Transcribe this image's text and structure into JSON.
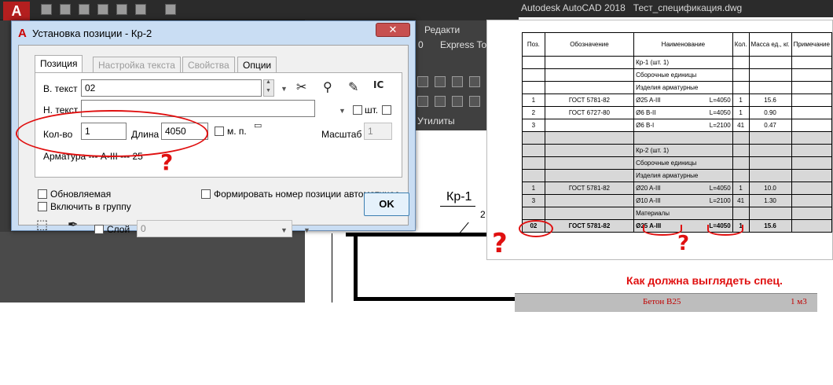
{
  "app": {
    "title_bar": "Autodesk AutoCAD 2018",
    "file": "Тест_спецификация.dwg",
    "ribbon": {
      "tab_redact": "Редакти",
      "tab_express": "Express Too",
      "num": "0",
      "utilities": "Утилиты"
    },
    "logo_letter": "A"
  },
  "drawing": {
    "label_kr1": "Кр-1",
    "leader_digit": "2"
  },
  "dialog": {
    "title": "Установка позиции - Кр-2",
    "close": "✕",
    "tabs": [
      {
        "label": "Позиция"
      },
      {
        "label": "Настройка текста"
      },
      {
        "label": "Свойства"
      },
      {
        "label": "Опции"
      }
    ],
    "v_text_label": "В. текст",
    "v_text_value": "02",
    "n_text_label": "Н. текст",
    "n_text_value": "",
    "sht_label": "шт.",
    "kol_label": "Кол-во",
    "kol_value": "1",
    "dlina_label": "Длина",
    "dlina_value": "4050",
    "mp_label": "м. п.",
    "masshtab_label": "Масштаб",
    "masshtab_value": "1",
    "armatura_text": "Арматура  ---  A-III  ---  25",
    "obnovl_label": "Обновляемая",
    "vkl_label": "Включить в группу",
    "form_label": "Формировать номер позиции автоматичес",
    "sloy_label": "Слой",
    "sloy_value": "0",
    "ok_label": "OK"
  },
  "annotations": {
    "q_left": "?",
    "q_mid": "?",
    "q_dialog": "?"
  },
  "spec": {
    "headers": [
      "Поз.",
      "Обозначение",
      "Наименование",
      "Кол.",
      "Масса ед., кг.",
      "Примечание"
    ],
    "rows": [
      {
        "pos": "",
        "obozn": "",
        "name": "Кр-1 (шт. 1)",
        "L": "",
        "kol": "",
        "massa": "",
        "style": ""
      },
      {
        "pos": "",
        "obozn": "",
        "name": "Сборочные единицы",
        "L": "",
        "kol": "",
        "massa": "",
        "style": ""
      },
      {
        "pos": "",
        "obozn": "",
        "name": "Изделия арматурные",
        "L": "",
        "kol": "",
        "massa": "",
        "style": ""
      },
      {
        "pos": "1",
        "obozn": "ГОСТ 5781-82",
        "name": "Ø25 A-III",
        "L": "L=4050",
        "kol": "1",
        "massa": "15.6",
        "style": ""
      },
      {
        "pos": "2",
        "obozn": "ГОСТ 6727-80",
        "name": "Ø6 B-II",
        "L": "L=4050",
        "kol": "1",
        "massa": "0.90",
        "style": ""
      },
      {
        "pos": "3",
        "obozn": "",
        "name": "Ø6 B-I",
        "L": "L=2100",
        "kol": "41",
        "massa": "0.47",
        "style": ""
      },
      {
        "pos": "",
        "obozn": "",
        "name": "",
        "L": "",
        "kol": "",
        "massa": "",
        "style": "dim"
      },
      {
        "pos": "",
        "obozn": "",
        "name": "Кр-2 (шт. 1)",
        "L": "",
        "kol": "",
        "massa": "",
        "style": "dim"
      },
      {
        "pos": "",
        "obozn": "",
        "name": "Сборочные единицы",
        "L": "",
        "kol": "",
        "massa": "",
        "style": "dim"
      },
      {
        "pos": "",
        "obozn": "",
        "name": "Изделия арматурные",
        "L": "",
        "kol": "",
        "massa": "",
        "style": "dim"
      },
      {
        "pos": "1",
        "obozn": "ГОСТ 5781-82",
        "name": "Ø20 A-III",
        "L": "L=4050",
        "kol": "1",
        "massa": "10.0",
        "style": "dim"
      },
      {
        "pos": "3",
        "obozn": "",
        "name": "Ø10 A-III",
        "L": "L=2100",
        "kol": "41",
        "massa": "1.30",
        "style": "dim"
      },
      {
        "pos": "",
        "obozn": "",
        "name": "Материалы",
        "L": "",
        "kol": "",
        "massa": "",
        "style": "dim"
      },
      {
        "pos": "02",
        "obozn": "ГОСТ 5781-82",
        "name": "Ø25 A-III",
        "L": "L=4050",
        "kol": "1",
        "massa": "15.6",
        "style": "dim bold"
      }
    ]
  },
  "caption": "Как должна выглядеть спец.",
  "beton": {
    "name": "Бетон В25",
    "qty": "1 м3"
  }
}
